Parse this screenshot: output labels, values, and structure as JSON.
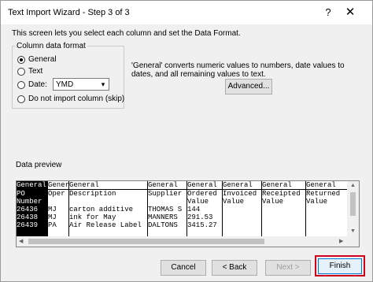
{
  "window": {
    "title": "Text Import Wizard - Step 3 of 3",
    "help_glyph": "?",
    "close_glyph": "✕"
  },
  "intro": "This screen lets you select each column and set the Data Format.",
  "column_format": {
    "group_label": "Column data format",
    "options": [
      {
        "label": "General",
        "checked": true
      },
      {
        "label": "Text",
        "checked": false
      },
      {
        "label": "Date:",
        "checked": false
      },
      {
        "label": "Do not import column (skip)",
        "checked": false
      }
    ],
    "date_format_value": "YMD"
  },
  "description": "'General' converts numeric values to numbers, date values to dates, and all remaining values to text.",
  "advanced_label": "Advanced...",
  "preview": {
    "label": "Data preview",
    "columns": [
      {
        "header": "General",
        "cells": [
          "PO",
          "Number",
          "26436",
          "26438",
          "26439"
        ],
        "selected": true
      },
      {
        "header": "General",
        "cells": [
          "Oper",
          "",
          "MJ",
          "MJ",
          "PA"
        ],
        "selected": false
      },
      {
        "header": "General",
        "cells": [
          "Description",
          "",
          "carton additive",
          "ink for May",
          "Air Release Label"
        ],
        "selected": false
      },
      {
        "header": "General",
        "cells": [
          "Supplier",
          "",
          "THOMAS S",
          "MANNERS",
          "DALTONS"
        ],
        "selected": false
      },
      {
        "header": "General",
        "cells": [
          "Ordered",
          "Value",
          "144",
          "291.53",
          "3415.27"
        ],
        "selected": false
      },
      {
        "header": "General",
        "cells": [
          "Invoiced",
          "Value",
          "",
          "",
          ""
        ],
        "selected": false
      },
      {
        "header": "General",
        "cells": [
          "Receipted",
          "Value",
          "",
          "",
          ""
        ],
        "selected": false
      },
      {
        "header": "General",
        "cells": [
          "Returned",
          "Value",
          "",
          "",
          ""
        ],
        "selected": false
      }
    ]
  },
  "buttons": {
    "cancel": "Cancel",
    "back": "< Back",
    "next": "Next >",
    "finish": "Finish"
  },
  "colors": {
    "highlight": "#d0021b",
    "default_button_border": "#0078d7"
  },
  "icons": {
    "dropdown": "chevron-down-icon",
    "scroll_up": "arrow-up-icon",
    "scroll_down": "arrow-down-icon",
    "scroll_left": "arrow-left-icon",
    "scroll_right": "arrow-right-icon"
  }
}
